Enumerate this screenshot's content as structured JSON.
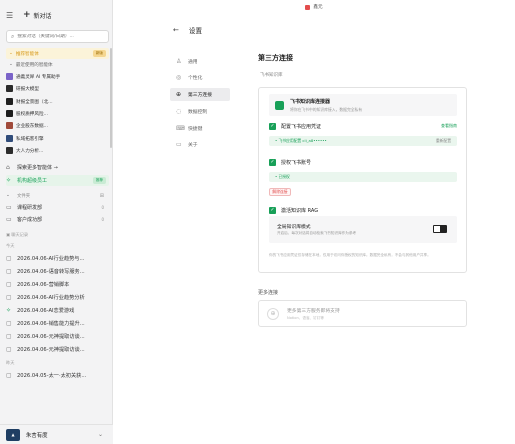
{
  "window": {
    "title": "鑫元"
  },
  "sidebar": {
    "new_chat_label": "新对话",
    "search_placeholder": "搜索对话（关键词/日期）...",
    "pinned_label": "推荐智能体",
    "pinned_badge": "新版",
    "recent_label": "最近使用的智能体",
    "apps": [
      {
        "name": "通義灵犀 AI 专属助手",
        "color": "#7a63c8"
      },
      {
        "name": "研报大模型",
        "color": "#2a2a2a"
      },
      {
        "name": "财报全景图（北...",
        "color": "#1f1f1f"
      },
      {
        "name": "股权质押风险...",
        "color": "#1d1d1d"
      },
      {
        "name": "企业股东数据...",
        "color": "#a04a3a"
      },
      {
        "name": "私域拓客引擎",
        "color": "#304c7a"
      },
      {
        "name": "大人力分析...",
        "color": "#2c2c2c"
      }
    ],
    "explore_label": "探索更多智能体 →",
    "ai_staff_label": "机构超级员工",
    "ai_staff_tag": "推荐",
    "files_label": "文件夹",
    "folders": [
      {
        "name": "课程研发部",
        "count": "0"
      },
      {
        "name": "客户成功部",
        "count": "0"
      }
    ],
    "history_label": "聊天记录",
    "today_label": "今天",
    "history_today": [
      "2026.04.06-AI行业趋势与...",
      "2026.04.06-语音转写服务...",
      "2026.04.06-营销脚本",
      "2026.04.06-AI行业趋势分析",
      "2026.04.06-AI恋爱游戏",
      "2026.04.06-销售能力提升...",
      "2026.04.06-元神提取访谈...",
      "2026.04.06-元神提取访谈..."
    ],
    "yesterday_label": "昨天",
    "history_yesterday": [
      "2026.04.05-太一·太初关获..."
    ],
    "user_name": "朱言有度"
  },
  "settings": {
    "back_label": "←",
    "title": "设置",
    "nav": [
      {
        "label": "通用",
        "icon": "user-icon"
      },
      {
        "label": "个性化",
        "icon": "palette-icon"
      },
      {
        "label": "第三方连接",
        "icon": "globe-icon",
        "active": true
      },
      {
        "label": "数据控制",
        "icon": "shield-icon"
      },
      {
        "label": "快捷键",
        "icon": "keyboard-icon"
      },
      {
        "label": "关于",
        "icon": "info-icon"
      }
    ]
  },
  "content": {
    "title": "第三方连接",
    "section_label": "飞书知识库",
    "connector_title": "飞书知识库连接器",
    "connector_desc": "将你在飞书中的知识库接入，数据完全私有",
    "step1_label": "配置飞书应用凭证",
    "step1_link": "查看指南",
    "step1_value": "• 飞书应用配置  cli_a8••••••",
    "step1_action": "重新配置",
    "step2_label": "授权飞书账号",
    "step2_value": "• 已授权",
    "step2_button": "解除连接",
    "step3_label": "激活知识库 RAG",
    "fullmode_title": "全局知识库模式",
    "fullmode_desc": "开启后，每次对话将自动检索飞书知识库作为参考",
    "note": "你的飞书应用凭证仅存储在本地，仅用于访问你授权的知识库。数据完全私有，不会与其他用户共享。",
    "more_title": "更多连接",
    "more_card_title": "更多第三方服务即将支持",
    "more_card_desc": "Notion、语雀、钉钉等"
  },
  "colors": {
    "accent": "#18a058",
    "danger": "#e04848",
    "sidebar_bg": "#f3f3f4"
  }
}
